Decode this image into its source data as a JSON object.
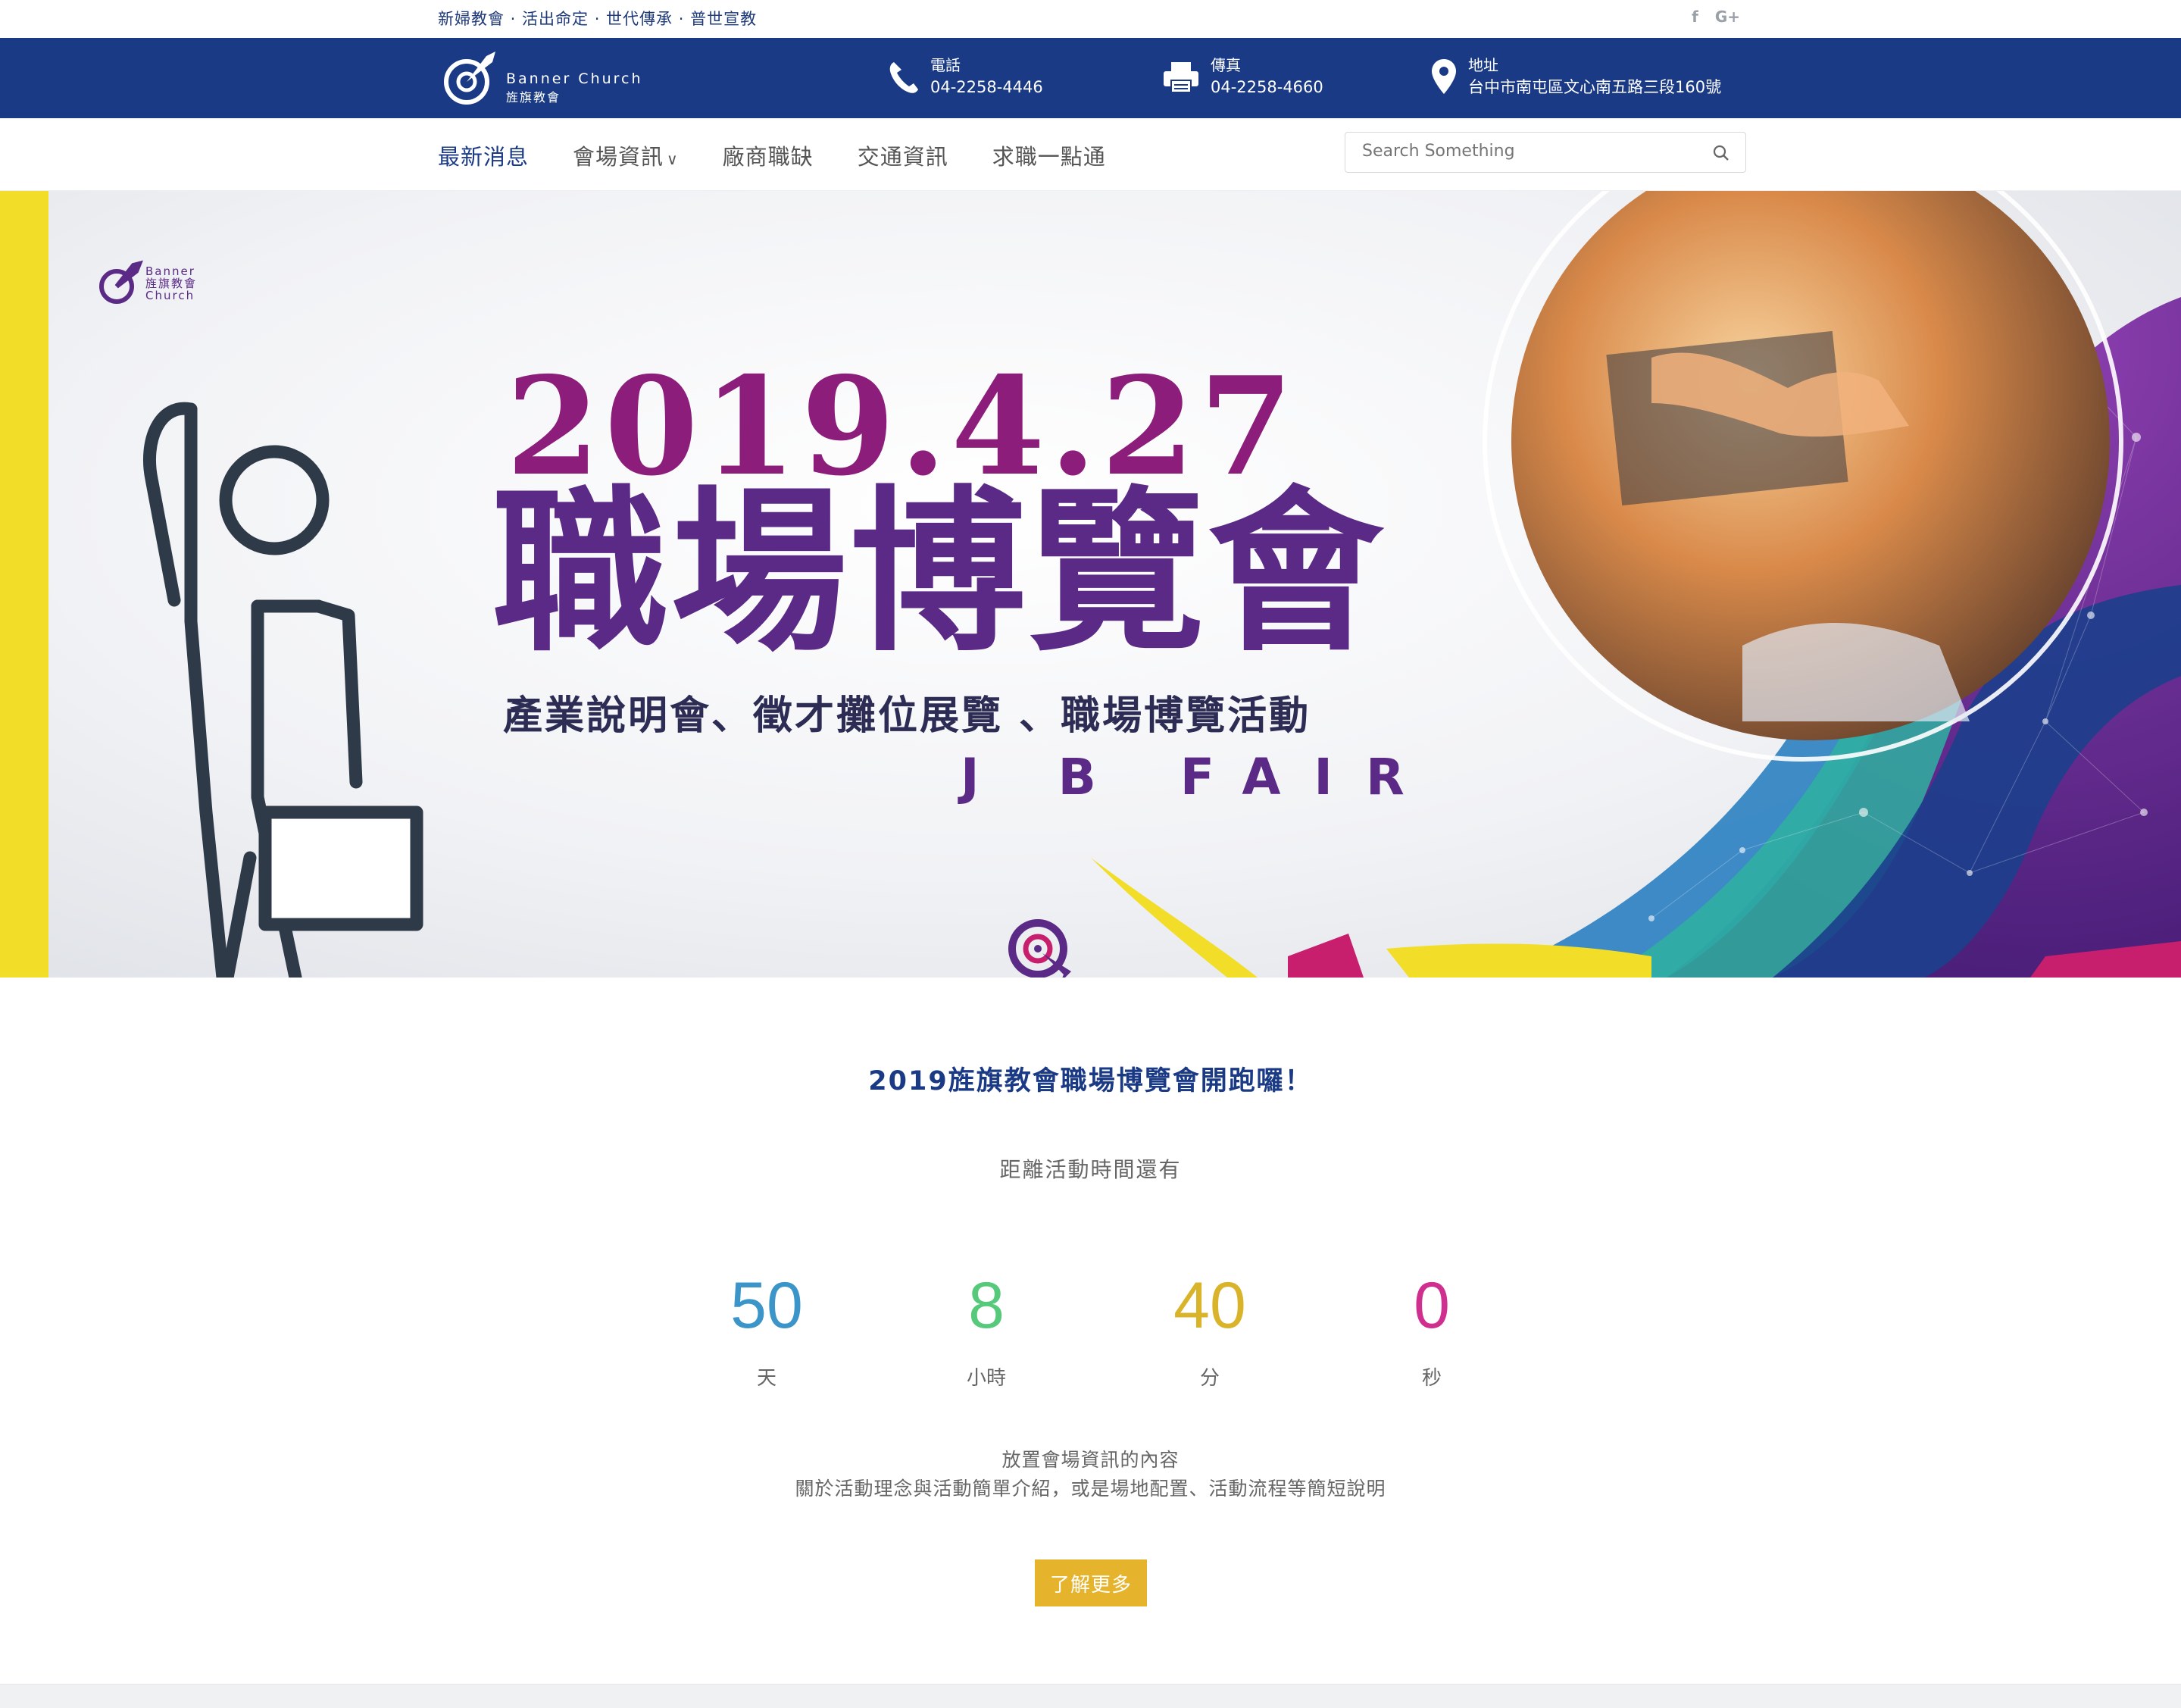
{
  "topbar": {
    "slogan": "新婦教會 · 活出命定 · 世代傳承 · 普世宣教",
    "social": [
      "facebook-icon",
      "google-plus-icon"
    ],
    "social_text": [
      "f",
      "G+"
    ]
  },
  "header": {
    "logo_en": "Banner Church",
    "logo_zh": "旌旗教會",
    "phone_label": "電話",
    "phone_value": "04-2258-4446",
    "fax_label": "傳真",
    "fax_value": "04-2258-4660",
    "address_label": "地址",
    "address_value": "台中市南屯區文心南五路三段160號"
  },
  "nav": {
    "items": [
      {
        "label": "最新消息",
        "active": true
      },
      {
        "label": "會場資訊",
        "has_dropdown": true
      },
      {
        "label": "廠商職缺"
      },
      {
        "label": "交通資訊"
      },
      {
        "label": "求職一點通"
      }
    ],
    "dropdown_arrow": "∨",
    "search_placeholder": "Search Something"
  },
  "hero": {
    "brand_line1": "Banner",
    "brand_line2": "旌旗教會",
    "brand_line3": "Church",
    "date": "2019.4.27",
    "title": "職場博覽會",
    "subtitle": "產業說明會、徵才攤位展覽 、職場博覽活動",
    "tagline_pre": "J",
    "tagline_post": "B FAIR"
  },
  "info": {
    "heading": "2019旌旗教會職場博覽會開跑囉！",
    "lead": "距離活動時間還有",
    "countdown": [
      {
        "value": "50",
        "unit": "天",
        "color": "#3b95c8"
      },
      {
        "value": "8",
        "unit": "小時",
        "color": "#56c97a"
      },
      {
        "value": "40",
        "unit": "分",
        "color": "#d9b42a"
      },
      {
        "value": "0",
        "unit": "秒",
        "color": "#cf2f8f"
      }
    ],
    "desc_line1": "放置會場資訊的內容",
    "desc_line2": "關於活動理念與活動簡單介紹，或是場地配置、活動流程等簡短說明",
    "more_button": "了解更多"
  },
  "colors": {
    "header_blue": "#1a3a85",
    "accent_yellow": "#e6b42c",
    "purple": "#5a2a86",
    "magenta": "#8c1d7a"
  }
}
